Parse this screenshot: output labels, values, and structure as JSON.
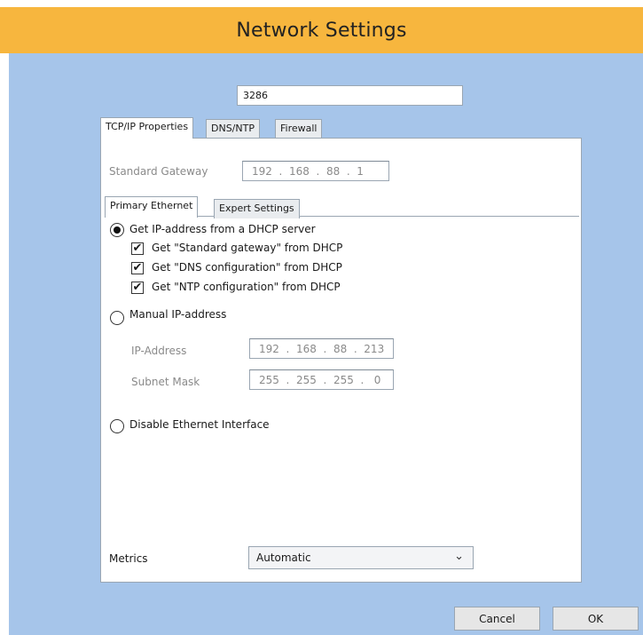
{
  "window": {
    "title": "Network Settings"
  },
  "device_field": {
    "value": "3286"
  },
  "tabs": [
    {
      "label": "TCP/IP Properties",
      "active": true
    },
    {
      "label": "DNS/NTP",
      "active": false
    },
    {
      "label": "Firewall",
      "active": false
    }
  ],
  "gateway": {
    "label": "Standard Gateway",
    "value": "192  .  168  .  88  .  1"
  },
  "subtabs": [
    {
      "label": "Primary Ethernet",
      "active": true
    },
    {
      "label": "Expert Settings",
      "active": false
    }
  ],
  "ip_mode": {
    "dhcp": {
      "label": "Get IP-address from a DHCP server",
      "selected": true
    },
    "dhcp_options": [
      {
        "label": "Get \"Standard gateway\" from DHCP",
        "checked": true
      },
      {
        "label": "Get \"DNS configuration\" from DHCP",
        "checked": true
      },
      {
        "label": "Get \"NTP configuration\" from DHCP",
        "checked": true
      }
    ],
    "manual": {
      "label": "Manual IP-address",
      "selected": false
    },
    "disable": {
      "label": "Disable Ethernet Interface",
      "selected": false
    }
  },
  "manual_fields": {
    "ip_label": "IP-Address",
    "ip_value": "192  .  168  .  88  .  213",
    "mask_label": "Subnet Mask",
    "mask_value": "255  .  255  .  255  .   0"
  },
  "metrics": {
    "label": "Metrics",
    "value": "Automatic"
  },
  "buttons": {
    "cancel": "Cancel",
    "ok": "OK"
  },
  "icons": {
    "check": "✔",
    "chevron": "⌄"
  },
  "colors": {
    "titlebar": "#f7b63e",
    "background": "#a6c5ea"
  }
}
